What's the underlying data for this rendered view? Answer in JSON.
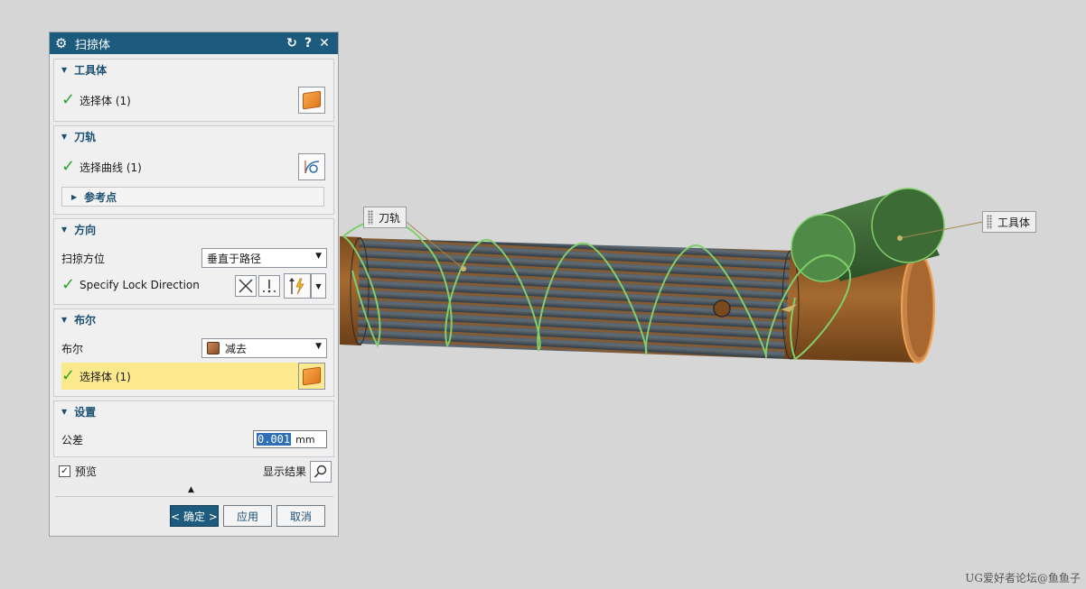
{
  "dialog": {
    "title": "扫掠体",
    "icons": {
      "title": "gear-icon",
      "reset": "reset-icon",
      "help": "help-icon",
      "close": "close-icon"
    },
    "tool_body": {
      "header": "工具体",
      "select_label": "选择体 (1)"
    },
    "path": {
      "header": "刀轨",
      "select_label": "选择曲线 (1)",
      "ref_point": "参考点"
    },
    "direction": {
      "header": "方向",
      "orientation_label": "扫掠方位",
      "orientation_value": "垂直于路径",
      "lock_label": "Specify Lock Direction"
    },
    "boolean": {
      "header": "布尔",
      "label": "布尔",
      "value": "减去",
      "select_label": "选择体 (1)"
    },
    "settings": {
      "header": "设置",
      "tolerance_label": "公差",
      "tolerance_value": "0.001",
      "unit": "mm"
    },
    "preview_label": "预览",
    "preview_checked": true,
    "show_result": "显示结果",
    "buttons": {
      "ok": "< 确定 >",
      "apply": "应用",
      "cancel": "取消"
    }
  },
  "viewport": {
    "tag_path": "刀轨",
    "tag_tool": "工具体",
    "colors": {
      "pipe": "#a0652c",
      "tool": "#3f6e38",
      "helix": "#7fcf6a",
      "core": "#3e4a54"
    }
  },
  "watermark": "UG爱好者论坛@鱼鱼子"
}
